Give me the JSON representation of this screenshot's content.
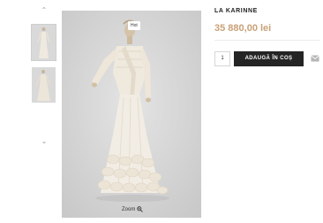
{
  "gallery": {
    "up_arrow_icon": "chevron-up-icon",
    "down_arrow_icon": "chevron-down-icon",
    "thumbnails": [
      "front-view",
      "back-view"
    ],
    "badge_label": "Hot",
    "zoom_label": "Zoom",
    "zoom_icon": "magnifier-icon"
  },
  "product": {
    "title": "LA KARINNE",
    "price": "35 880,00 lei",
    "quantity": "1",
    "add_to_cart_label": "ADAUGĂ ÎN COȘ",
    "email_icon": "envelope-icon"
  },
  "colors": {
    "price": "#c9a178",
    "button_bg": "#242424"
  }
}
